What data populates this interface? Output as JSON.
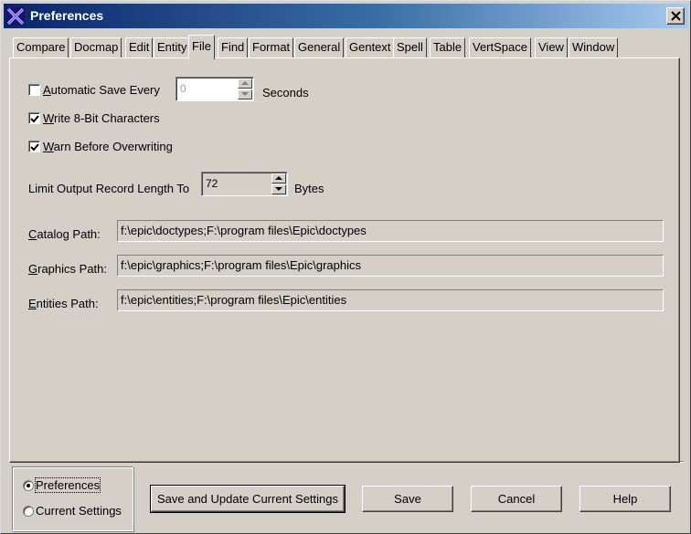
{
  "window": {
    "title": "Preferences",
    "app_icon": "epic-x-icon",
    "close_icon": "close-icon"
  },
  "tabs": [
    {
      "label": "Compare",
      "active": false
    },
    {
      "label": "Docmap",
      "active": false
    },
    {
      "label": "Edit",
      "active": false
    },
    {
      "label": "Entity",
      "active": false
    },
    {
      "label": "File",
      "active": true
    },
    {
      "label": "Find",
      "active": false
    },
    {
      "label": "Format",
      "active": false
    },
    {
      "label": "General",
      "active": false
    },
    {
      "label": "Gentext",
      "active": false
    },
    {
      "label": "Spell",
      "active": false
    },
    {
      "label": "Table",
      "active": false
    },
    {
      "label": "VertSpace",
      "active": false
    },
    {
      "label": "View",
      "active": false
    },
    {
      "label": "Window",
      "active": false
    }
  ],
  "file_tab": {
    "autosave": {
      "accel": "A",
      "label_rest": "utomatic Save Every",
      "checked": false,
      "value": "0",
      "unit": "Seconds"
    },
    "write8bit": {
      "accel": "W",
      "label_rest": "rite 8-Bit Characters",
      "checked": true
    },
    "warn_overwrite": {
      "accel": "W",
      "label_rest": "arn Before Overwriting",
      "checked": true
    },
    "limit_output": {
      "label": "Limit Output Record Length To",
      "value": "72",
      "unit": "Bytes"
    },
    "catalog_path": {
      "accel": "C",
      "label_rest": "atalog Path:",
      "value": "f:\\epic\\doctypes;F:\\program files\\Epic\\doctypes"
    },
    "graphics_path": {
      "accel": "G",
      "label_rest": "raphics Path:",
      "value": "f:\\epic\\graphics;F:\\program files\\Epic\\graphics"
    },
    "entities_path": {
      "accel": "E",
      "label_rest": "ntities Path:",
      "value": "f:\\epic\\entities;F:\\program files\\Epic\\entities"
    }
  },
  "scope": {
    "selected": "Preferences",
    "preferences_label": "Preferences",
    "current_label": "Current Settings"
  },
  "buttons": {
    "save_update": "Save and Update Current Settings",
    "save": "Save",
    "cancel": "Cancel",
    "help": "Help"
  }
}
